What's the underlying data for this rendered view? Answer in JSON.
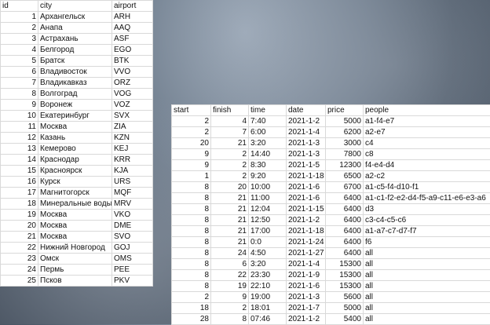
{
  "cities": {
    "headers": {
      "id": "id",
      "city": "city",
      "airport": "airport"
    },
    "rows": [
      {
        "id": "1",
        "city": "Архангельск",
        "airport": "ARH"
      },
      {
        "id": "2",
        "city": "Анапа",
        "airport": "AAQ"
      },
      {
        "id": "3",
        "city": "Астрахань",
        "airport": "ASF"
      },
      {
        "id": "4",
        "city": "Белгород",
        "airport": "EGO"
      },
      {
        "id": "5",
        "city": "Братск",
        "airport": "BTK"
      },
      {
        "id": "6",
        "city": "Владивосток",
        "airport": "VVO"
      },
      {
        "id": "7",
        "city": "Владикавказ",
        "airport": "ORZ"
      },
      {
        "id": "8",
        "city": "Волгоград",
        "airport": "VOG"
      },
      {
        "id": "9",
        "city": "Воронеж",
        "airport": "VOZ"
      },
      {
        "id": "10",
        "city": "Екатеринбург",
        "airport": "SVX"
      },
      {
        "id": "11",
        "city": "Москва",
        "airport": "ZIA"
      },
      {
        "id": "12",
        "city": "Казань",
        "airport": "KZN"
      },
      {
        "id": "13",
        "city": "Кемерово",
        "airport": "KEJ"
      },
      {
        "id": "14",
        "city": "Краснодар",
        "airport": "KRR"
      },
      {
        "id": "15",
        "city": "Красноярск",
        "airport": "KJA"
      },
      {
        "id": "16",
        "city": "Курск",
        "airport": "URS"
      },
      {
        "id": "17",
        "city": "Магнитогорск",
        "airport": "MQF"
      },
      {
        "id": "18",
        "city": "Минеральные воды",
        "airport": "MRV"
      },
      {
        "id": "19",
        "city": "Москва",
        "airport": "VKO"
      },
      {
        "id": "20",
        "city": "Москва",
        "airport": "DME"
      },
      {
        "id": "21",
        "city": "Москва",
        "airport": "SVO"
      },
      {
        "id": "22",
        "city": "Нижний Новгород",
        "airport": "GOJ"
      },
      {
        "id": "23",
        "city": "Омск",
        "airport": "OMS"
      },
      {
        "id": "24",
        "city": "Пермь",
        "airport": "PEE"
      },
      {
        "id": "25",
        "city": "Псков",
        "airport": "PKV"
      }
    ]
  },
  "flights": {
    "headers": {
      "start": "start",
      "finish": "finish",
      "time": "time",
      "date": "date",
      "price": "price",
      "people": "people"
    },
    "rows": [
      {
        "start": "2",
        "finish": "4",
        "time": "7:40",
        "date": "2021-1-2",
        "price": "5000",
        "people": "a1-f4-e7"
      },
      {
        "start": "2",
        "finish": "7",
        "time": "6:00",
        "date": "2021-1-4",
        "price": "6200",
        "people": "a2-e7"
      },
      {
        "start": "20",
        "finish": "21",
        "time": "3:20",
        "date": "2021-1-3",
        "price": "3000",
        "people": "c4"
      },
      {
        "start": "9",
        "finish": "2",
        "time": "14:40",
        "date": "2021-1-3",
        "price": "7800",
        "people": "c8"
      },
      {
        "start": "9",
        "finish": "2",
        "time": "8:30",
        "date": "2021-1-5",
        "price": "12300",
        "people": "f4-e4-d4"
      },
      {
        "start": "1",
        "finish": "2",
        "time": "9:20",
        "date": "2021-1-18",
        "price": "6500",
        "people": "a2-c2"
      },
      {
        "start": "8",
        "finish": "20",
        "time": "10:00",
        "date": "2021-1-6",
        "price": "6700",
        "people": "a1-c5-f4-d10-f1"
      },
      {
        "start": "8",
        "finish": "21",
        "time": "11:00",
        "date": "2021-1-6",
        "price": "6400",
        "people": "a1-c1-f2-e2-d4-f5-a9-c11-e6-e3-a6"
      },
      {
        "start": "8",
        "finish": "21",
        "time": "12:04",
        "date": "2021-1-15",
        "price": "6400",
        "people": "d3"
      },
      {
        "start": "8",
        "finish": "21",
        "time": "12:50",
        "date": "2021-1-2",
        "price": "6400",
        "people": "c3-c4-c5-c6"
      },
      {
        "start": "8",
        "finish": "21",
        "time": "17:00",
        "date": "2021-1-18",
        "price": "6400",
        "people": "a1-a7-c7-d7-f7"
      },
      {
        "start": "8",
        "finish": "21",
        "time": "0:0",
        "date": "2021-1-24",
        "price": "6400",
        "people": "f6"
      },
      {
        "start": "8",
        "finish": "24",
        "time": "4:50",
        "date": "2021-1-27",
        "price": "6400",
        "people": "all"
      },
      {
        "start": "8",
        "finish": "6",
        "time": "3:20",
        "date": "2021-1-4",
        "price": "15300",
        "people": "all"
      },
      {
        "start": "8",
        "finish": "22",
        "time": "23:30",
        "date": "2021-1-9",
        "price": "15300",
        "people": "all"
      },
      {
        "start": "8",
        "finish": "19",
        "time": "22:10",
        "date": "2021-1-6",
        "price": "15300",
        "people": "all"
      },
      {
        "start": "2",
        "finish": "9",
        "time": "19:00",
        "date": "2021-1-3",
        "price": "5600",
        "people": "all"
      },
      {
        "start": "18",
        "finish": "2",
        "time": "18:01",
        "date": "2021-1-7",
        "price": "5000",
        "people": "all"
      },
      {
        "start": "28",
        "finish": "8",
        "time": "07:46",
        "date": "2021-1-2",
        "price": "5400",
        "people": "all"
      }
    ]
  }
}
